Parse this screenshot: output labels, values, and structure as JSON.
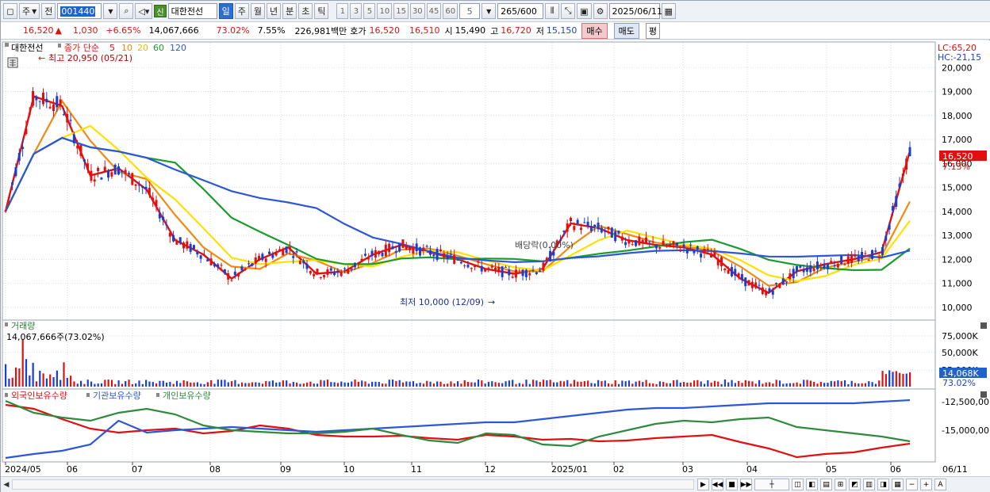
{
  "toolbar": {
    "type_label": "주",
    "prev_label": "전",
    "code": "001440",
    "new_badge": "신",
    "stock_name": "대한전선",
    "periods": [
      "일",
      "주",
      "월",
      "년",
      "분",
      "초",
      "틱"
    ],
    "active_period": "일",
    "intervals": [
      "1",
      "3",
      "5",
      "10",
      "15",
      "30",
      "45",
      "60"
    ],
    "interval_value": "5",
    "count": "265",
    "count_max": "/600",
    "date": "2025/06/11"
  },
  "quote": {
    "price": "16,520",
    "change": "1,030",
    "change_pct": "+6.65%",
    "volume": "14,067,666",
    "volume_ratio": "73.02%",
    "turnover": "7.55%",
    "amount": "226,981백만",
    "bid_label": "호가",
    "ask": "16,520",
    "bid": "16,510",
    "open_label": "시",
    "open": "15,490",
    "high_label": "고",
    "high": "16,720",
    "low_label": "저",
    "low": "15,150",
    "buy_label": "매수",
    "sell_label": "매도",
    "flat_label": "평"
  },
  "price_panel": {
    "stock_label": "대한전선",
    "ma_label": "종가 단순",
    "ma_periods": [
      "5",
      "10",
      "20",
      "60",
      "120"
    ],
    "ma_colors": [
      "#e01010",
      "#f08a10",
      "#ffe000",
      "#1c9a2c",
      "#2c58d8"
    ],
    "lc_label": "LC:65,20",
    "hc_label": "HC:-21,15",
    "high_annotation": "최고 20,950 (05/21)",
    "low_annotation": "최저 10,000 (12/09)",
    "dividend_annotation": "배당락(0.00%)",
    "y_ticks": [
      "20,000",
      "19,000",
      "18,000",
      "17,000",
      "16,000",
      "15,000",
      "14,000",
      "13,000",
      "12,000",
      "11,000",
      "10,000"
    ],
    "current_price_tag": "16,520",
    "current_pct_tag": "7.13%"
  },
  "volume_panel": {
    "title": "거래량",
    "value_text": "14,067,666주(73.02%)",
    "y_ticks": [
      "75,000K",
      "50,000K",
      "25,000K"
    ],
    "current_tag": "14,068K",
    "current_pct_tag": "73.02%"
  },
  "holding_panel": {
    "series": [
      "외국인보유수량",
      "기관보유수량",
      "개인보유수량"
    ],
    "series_colors": [
      "#e01010",
      "#2c58d8",
      "#2e8b3e"
    ],
    "y_ticks": [
      "-12,500,00",
      "-15,000,00"
    ]
  },
  "x_axis": {
    "labels": [
      "2024/05",
      "06",
      "07",
      "08",
      "09",
      "10",
      "11",
      "12",
      "2025/01",
      "02",
      "03",
      "04",
      "05",
      "06"
    ],
    "right_label": "06/11"
  },
  "chart_data": {
    "type": "line",
    "title": "대한전선",
    "ylim": [
      9500,
      21000
    ],
    "high": 20950,
    "low": 10000,
    "last_close": 16520,
    "months": [
      "2024/05",
      "06",
      "07",
      "08",
      "09",
      "10",
      "11",
      "12",
      "2025/01",
      "02",
      "03",
      "04",
      "05",
      "06"
    ],
    "close_approx": [
      14000,
      18800,
      18400,
      15500,
      15800,
      14900,
      12800,
      12200,
      11200,
      12000,
      12500,
      11400,
      11500,
      12200,
      12600,
      12300,
      12000,
      11600,
      11400,
      11600,
      13500,
      13300,
      12800,
      12600,
      12500,
      12200,
      11200,
      10600,
      11500,
      11800,
      12000,
      12300,
      16520
    ]
  }
}
